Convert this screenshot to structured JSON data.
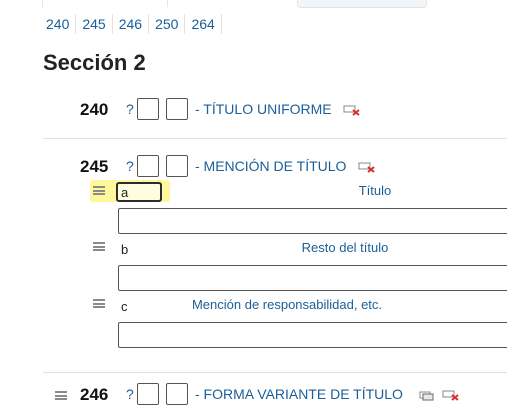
{
  "quicknav": [
    "240",
    "245",
    "246",
    "250",
    "264"
  ],
  "section_title": "Sección 2",
  "help_symbol": "?",
  "fields": [
    {
      "tag": "240",
      "description": "- TÍTULO UNIFORME"
    },
    {
      "tag": "245",
      "description": "- MENCIÓN DE TÍTULO",
      "subfields": [
        {
          "code": "a",
          "label": "Título"
        },
        {
          "code": "b",
          "label": "Resto del título"
        },
        {
          "code": "c",
          "label": "Mención de responsabilidad, etc."
        }
      ]
    },
    {
      "tag": "246",
      "description": "- FORMA VARIANTE DE TÍTULO"
    }
  ],
  "colors": {
    "link": "#1a5f99",
    "highlight": "#fff68a",
    "delete_icon": "#d9302c"
  }
}
